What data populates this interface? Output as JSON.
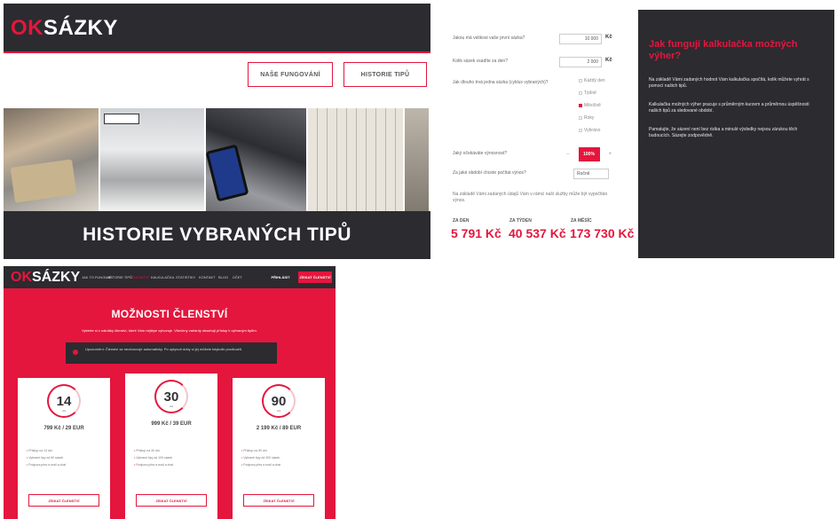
{
  "brand": {
    "logo_ok": "OK",
    "logo_rest": "SÁZKY",
    "accent_color": "#e4163d",
    "dark_color": "#2b2b30"
  },
  "panel1": {
    "buttons": [
      "NAŠE FUNGOVÁNÍ",
      "HISTORIE TIPŮ"
    ],
    "photos": [
      "photo-money-cash",
      "photo-team-office",
      "photo-phone-counter",
      "photo-ticket-board",
      "photo-partial"
    ],
    "footer_title": "HISTORIE VYBRANÝCH TIPŮ"
  },
  "calculator": {
    "q1": "Jakou má velikost vaše první sázka?",
    "q1_value": "10 000",
    "q1_unit": "Kč",
    "q2": "Kolik sázek vsadíte za den?",
    "q2_value": "2 000",
    "q2_unit": "Kč",
    "q3": "Jak dlouho trvá jedna sázka (cyklus vybraných)?",
    "q3_options": [
      "Každý den",
      "Týdně",
      "Měsíčně",
      "Roky",
      "Vybráno"
    ],
    "q3_selected_index": 2,
    "q4": "Jaký očekáváte výnosnost?",
    "q4_value": "100%",
    "q4_minus": "−",
    "q4_plus": "+",
    "q5": "Za jaké období chcete počítat výnos?",
    "q5_value": "Ročně",
    "note": "Na základě Vámi zadaných údajů Vám v rámci naší služby může být vypočítán výnos.",
    "results": [
      {
        "label": "ZA DEN",
        "value": "5 791 Kč"
      },
      {
        "label": "ZA TÝDEN",
        "value": "40 537 Kč"
      },
      {
        "label": "ZA MĚSÍC",
        "value": "173 730 Kč"
      }
    ]
  },
  "info": {
    "title": "Jak fungují kalkulačka možných výher?",
    "paragraphs": [
      "Na základě Vámi zadaných hodnot Vám kalkulačka spočítá, kolik můžete vyhrát s pomocí našich tipů.",
      "Kalkulačka možných výher pracuje s průměrným kurzem a průměrnou úspěšností našich tipů za sledované období.",
      "Pamatujte, že sázení není bez rizika a minulé výsledky nejsou zárukou těch budoucích. Sázejte zodpovědně."
    ]
  },
  "membership": {
    "nav_items": [
      "Jak to funguje",
      "Historie tipů",
      "Členství",
      "Kalkulačka",
      "Statistiky",
      "Kontakt",
      "Blog",
      "Účet"
    ],
    "nav_active_index": 2,
    "nav_login": "PŘIHLÁSIT",
    "nav_cta": "ZÍSKAT ČLENSTVÍ",
    "title": "MOŽNOSTI ČLENSTVÍ",
    "subtitle": "Vyberte si z nabídky členství, které Vám nejlépe vyhovuje. Všechny varianty obsahují přístup k vybraným tipům.",
    "notice": "Upozornění: Členství se neobnovuje automaticky. Po uplynutí doby si jej můžete kdykoliv prodloužit.",
    "plans": [
      {
        "days": "14",
        "unit": "dní",
        "price": "799 Kč / 29 EUR",
        "features": [
          "Přístup na 14 dní",
          "Vybrané tipy až 50 sázek",
          "Podpora přes e-mail a chat"
        ],
        "cta": "ZÍSKAT ČLENSTVÍ"
      },
      {
        "days": "30",
        "unit": "dní",
        "price": "999 Kč / 39 EUR",
        "features": [
          "Přístup na 30 dní",
          "Vybrané tipy až 100 sázek",
          "Podpora přes e-mail a chat"
        ],
        "cta": "ZÍSKAT ČLENSTVÍ"
      },
      {
        "days": "90",
        "unit": "dní",
        "price": "2 199 Kč / 89 EUR",
        "features": [
          "Přístup na 90 dní",
          "Vybrané tipy až 300 sázek",
          "Podpora přes e-mail a chat"
        ],
        "cta": "ZÍSKAT ČLENSTVÍ"
      }
    ]
  }
}
